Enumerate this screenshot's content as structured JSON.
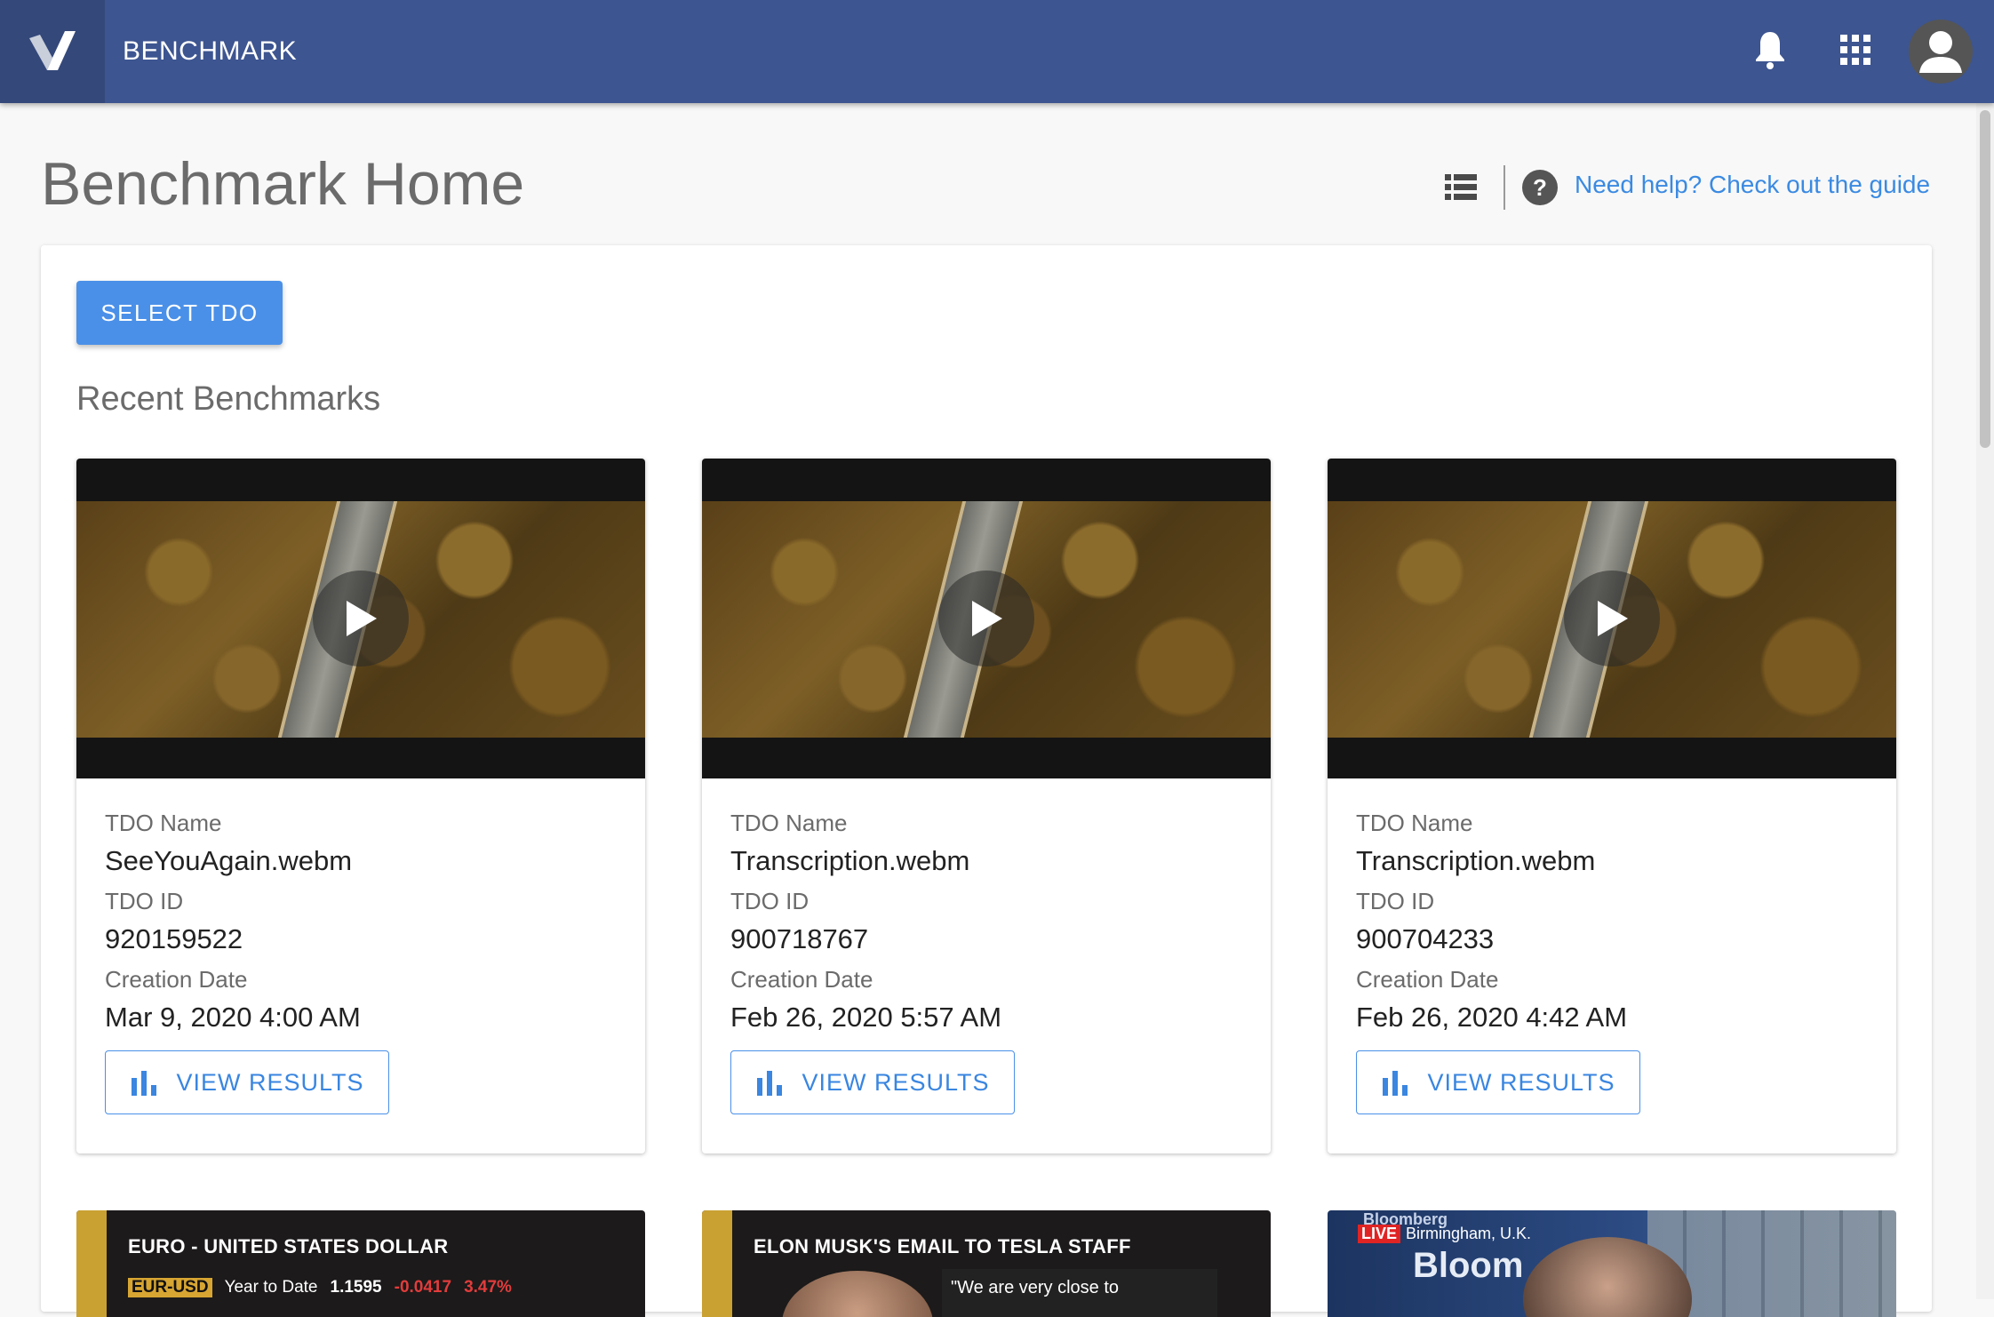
{
  "app": {
    "name": "BENCHMARK"
  },
  "page": {
    "title": "Benchmark Home",
    "help_link": "Need help? Check out the guide",
    "select_button": "SELECT TDO",
    "section_title": "Recent Benchmarks"
  },
  "labels": {
    "tdo_name": "TDO Name",
    "tdo_id": "TDO ID",
    "creation_date": "Creation Date",
    "view_results": "VIEW RESULTS"
  },
  "cards": [
    {
      "tdo_name": "SeeYouAgain.webm",
      "tdo_id": "920159522",
      "creation_date": "Mar 9, 2020 4:00 AM"
    },
    {
      "tdo_name": "Transcription.webm",
      "tdo_id": "900718767",
      "creation_date": "Feb 26, 2020 5:57 AM"
    },
    {
      "tdo_name": "Transcription.webm",
      "tdo_id": "900704233",
      "creation_date": "Feb 26, 2020 4:42 AM"
    }
  ],
  "thumbnails": [
    {
      "headline": "EURO - UNITED STATES DOLLAR",
      "ticker_tag": "EUR-USD",
      "ticker_label": "Year to Date",
      "ticker_value": "1.1595",
      "ticker_change": "-0.0417",
      "ticker_percent": "3.47%"
    },
    {
      "headline": "ELON MUSK'S EMAIL TO TESLA STAFF",
      "quote": "\"We are very close to"
    },
    {
      "network": "Bloomberg",
      "live": "LIVE",
      "location": "Birmingham, U.K.",
      "brand": "Bloom"
    }
  ],
  "colors": {
    "appbar": "#3d5590",
    "accent": "#4a90e8",
    "link": "#3a8ae2"
  },
  "icons": [
    "logo-icon",
    "bell-icon",
    "apps-grid-icon",
    "account-icon",
    "list-view-icon",
    "help-icon",
    "play-icon",
    "bar-chart-icon"
  ]
}
